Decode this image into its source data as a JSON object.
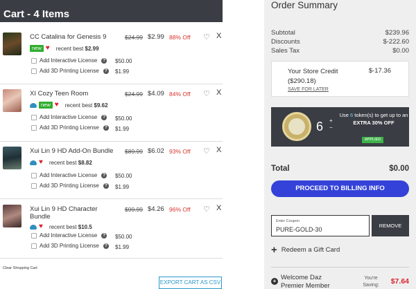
{
  "cart": {
    "title": "Cart - 4 Items",
    "items": [
      {
        "title": "CC Catalina for Genesis 9",
        "old_price": "$24.99",
        "price": "$2.99",
        "off": "88% Off",
        "new_badge": "new",
        "recent_label": "recent best",
        "recent_price": "$2.99",
        "interactive_label": "Add Interactive License",
        "interactive_price": "$50.00",
        "printing_label": "Add 3D Printing License",
        "printing_price": "$1.99"
      },
      {
        "title": "XI Cozy Teen Room",
        "old_price": "$24.99",
        "price": "$4.09",
        "off": "84% Off",
        "new_badge": "new",
        "recent_label": "recent best",
        "recent_price": "$9.62",
        "interactive_label": "Add Interactive License",
        "interactive_price": "$50.00",
        "printing_label": "Add 3D Printing License",
        "printing_price": "$1.99"
      },
      {
        "title": "Xui Lin 9 HD Add-On Bundle",
        "old_price": "$89.99",
        "price": "$6.02",
        "off": "93% Off",
        "recent_label": "recent best",
        "recent_price": "$8.82",
        "interactive_label": "Add Interactive License",
        "interactive_price": "$50.00",
        "printing_label": "Add 3D Printing License",
        "printing_price": "$1.99"
      },
      {
        "title": "Xui Lin 9 HD Character Bundle",
        "old_price": "$99.99",
        "price": "$4.26",
        "off": "96% Off",
        "recent_label": "recent best",
        "recent_price": "$10.5",
        "interactive_label": "Add Interactive License",
        "interactive_price": "$50.00",
        "printing_label": "Add 3D Printing License",
        "printing_price": "$1.99"
      }
    ],
    "clear_label": "Clear Shopping Cart",
    "export_label": "EXPORT CART AS CSV"
  },
  "summary": {
    "title": "Order Summary",
    "subtotal_label": "Subtotal",
    "subtotal_value": "$239.96",
    "discounts_label": "Discounts",
    "discounts_value": "$-222.60",
    "tax_label": "Sales Tax",
    "tax_value": "$0.00",
    "credit_label": "Your Store Credit ($290.18)",
    "credit_value": "$-17.36",
    "save_later": "SAVE FOR LATER",
    "token_count": "6",
    "token_plus": "+",
    "token_minus": "−",
    "token_text_pre": "Use",
    "token_text_num": "6",
    "token_text_mid": "token(s) to get up to an",
    "token_text_bold": "EXTRA 30% OFF",
    "applied": "APPLIED",
    "total_label": "Total",
    "total_value": "$0.00",
    "proceed_label": "PROCEED TO BILLING INFO",
    "coupon_label": "Enter Coupon",
    "coupon_value": "PURE-GOLD-30",
    "remove_label": "REMOVE",
    "gift_label": "Redeem a Gift Card",
    "premier_text": "Welcome Daz Premier Member",
    "premier_save": "You're Saving:",
    "premier_amount": "$7.64"
  },
  "colors": {
    "header_bg": "#3a3d44",
    "accent_blue": "#3442d9",
    "discount_red": "#d9342b",
    "new_green": "#2fae2f"
  }
}
